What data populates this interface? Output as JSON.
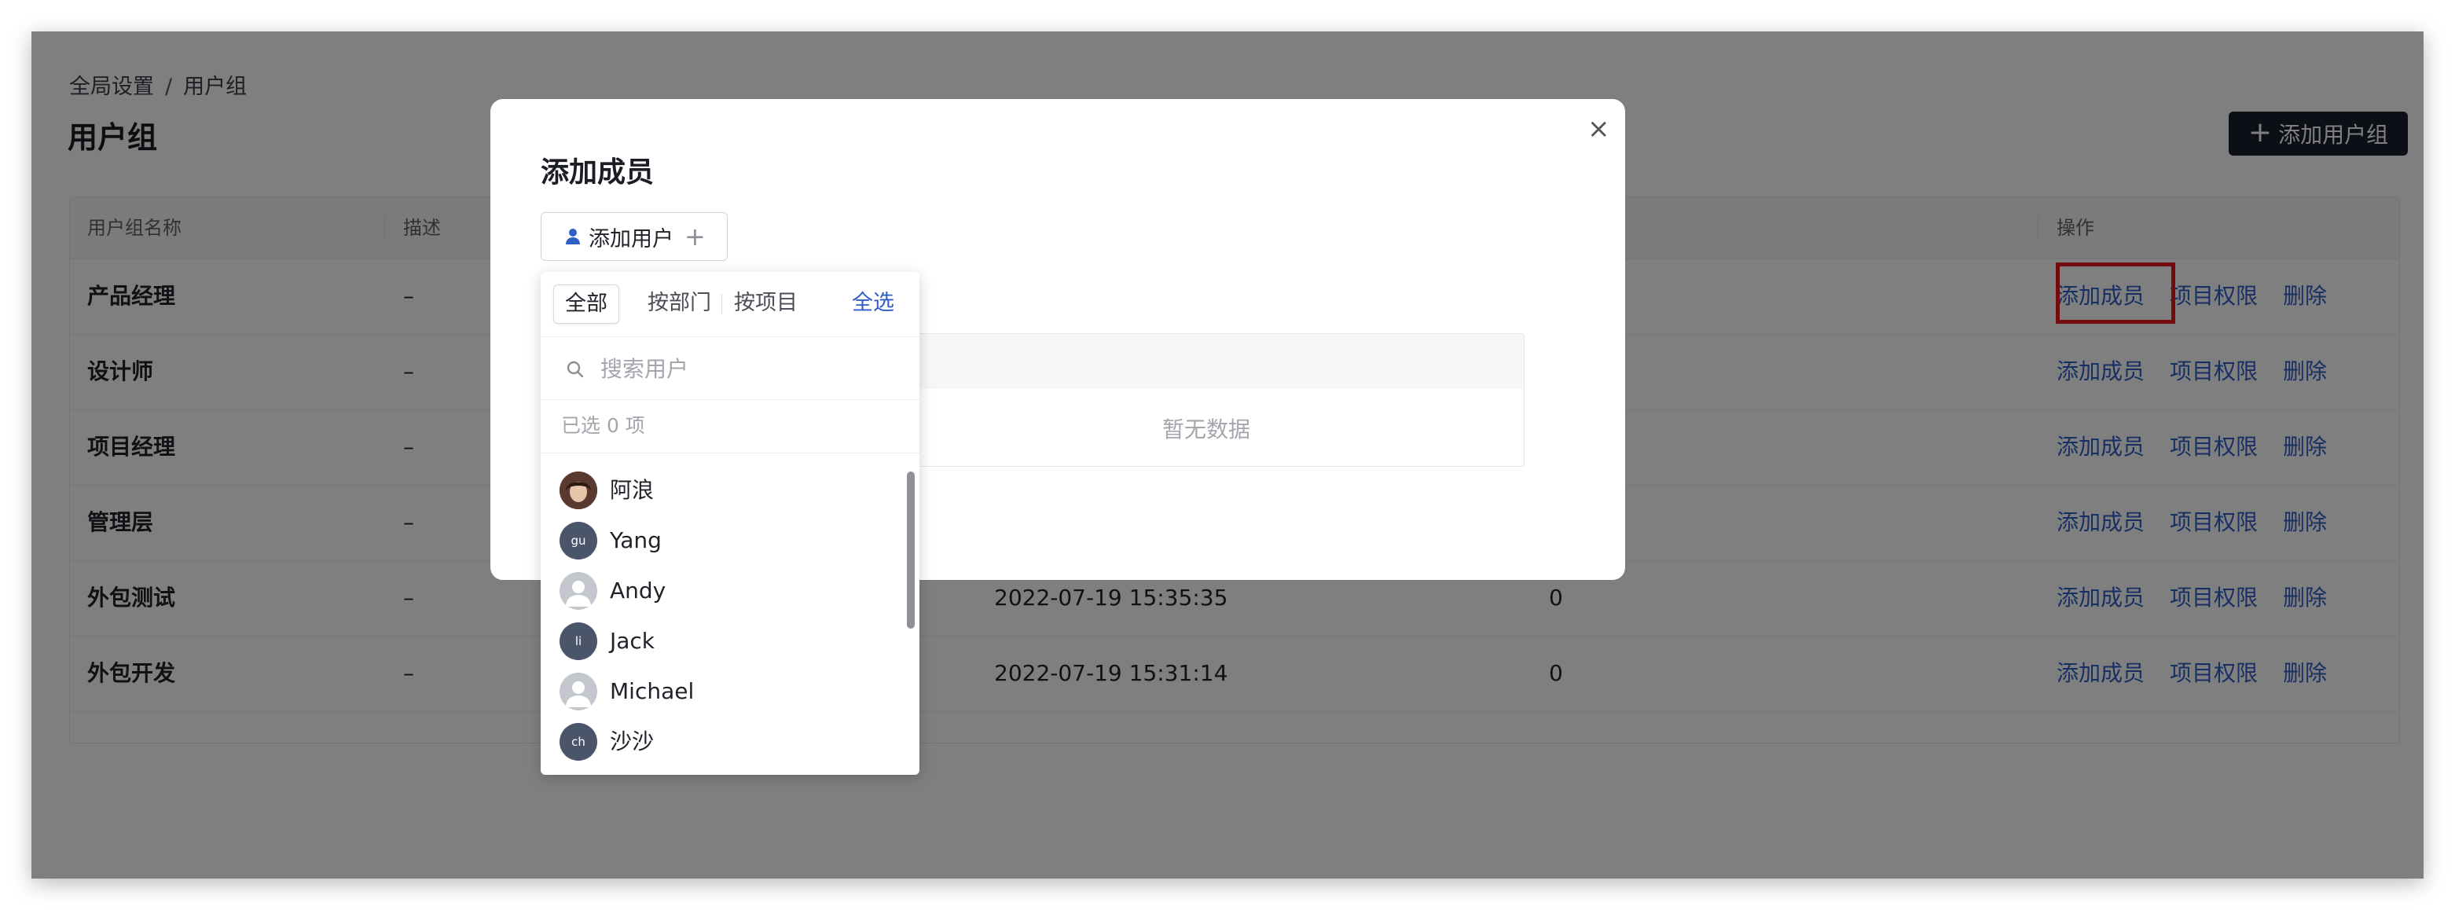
{
  "page": {
    "breadcrumb": [
      "全局设置",
      "用户组"
    ],
    "breadcrumb_sep": "/",
    "title": "用户组",
    "add_group_button": "添加用户组"
  },
  "table": {
    "headers": [
      "用户组名称",
      "描述",
      "操作"
    ],
    "rows": [
      {
        "name": "产品经理",
        "desc": "–",
        "created": "",
        "count": ""
      },
      {
        "name": "设计师",
        "desc": "–",
        "created": "",
        "count": ""
      },
      {
        "name": "项目经理",
        "desc": "–",
        "created": "",
        "count": ""
      },
      {
        "name": "管理层",
        "desc": "–",
        "created": "",
        "count": ""
      },
      {
        "name": "外包测试",
        "desc": "–",
        "created": "2022-07-19 15:35:35",
        "count": "0"
      },
      {
        "name": "外包开发",
        "desc": "–",
        "created": "2022-07-19 15:31:14",
        "count": "0"
      }
    ],
    "actions": {
      "add_member": "添加成员",
      "project_permission": "项目权限",
      "delete": "删除"
    }
  },
  "modal": {
    "title": "添加成员",
    "close_glyph": "×",
    "add_user_button": "添加用户",
    "empty_text": "暂无数据"
  },
  "dropdown": {
    "tabs": [
      "全部",
      "按部门",
      "按项目"
    ],
    "active_tab": "全部",
    "select_all": "全选",
    "search_placeholder": "搜索用户",
    "selected_count_text": "已选 0 项",
    "users": [
      {
        "name": "阿浪",
        "avatar": "photo",
        "initials": ""
      },
      {
        "name": "Yang",
        "avatar": "initials",
        "initials": "gu"
      },
      {
        "name": "Andy",
        "avatar": "default",
        "initials": ""
      },
      {
        "name": "Jack",
        "avatar": "initials",
        "initials": "li"
      },
      {
        "name": "Michael",
        "avatar": "default",
        "initials": ""
      },
      {
        "name": "沙沙",
        "avatar": "initials",
        "initials": "ch"
      }
    ]
  },
  "colors": {
    "accent": "#2f5ec4",
    "highlight": "#e8161f",
    "dark_button": "#1a1f2c"
  }
}
